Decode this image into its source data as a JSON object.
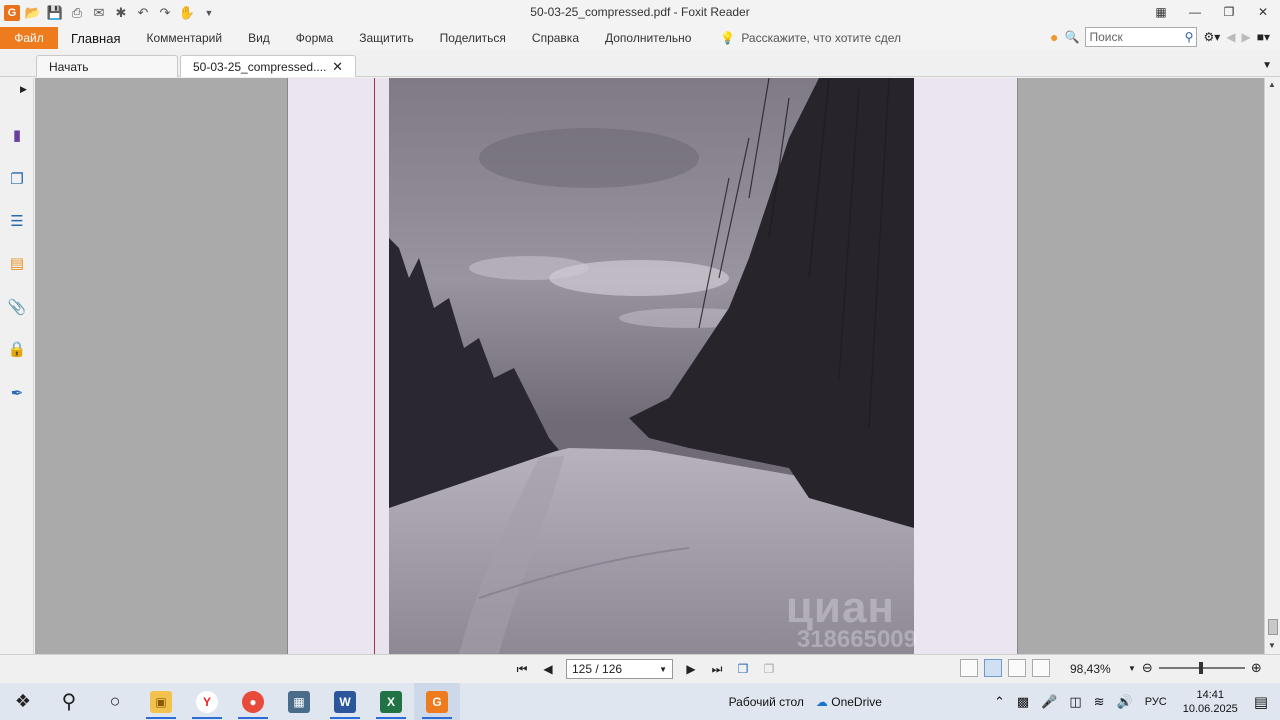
{
  "window": {
    "title": "50-03-25_compressed.pdf - Foxit Reader"
  },
  "menu": {
    "file": "Файл",
    "items": [
      "Главная",
      "Комментарий",
      "Вид",
      "Форма",
      "Защитить",
      "Поделиться",
      "Справка",
      "Дополнительно"
    ],
    "tell_me": "Расскажите, что хотите сдел",
    "search_placeholder": "Поиск"
  },
  "tabs": {
    "start": "Начать",
    "doc": "50-03-25_compressed...."
  },
  "watermark": {
    "line1": "циан",
    "line2": "318665009"
  },
  "status": {
    "page": "125 / 126",
    "zoom": "98,43%"
  },
  "taskbar": {
    "desktop_label": "Рабочий стол",
    "onedrive_label": "OneDrive",
    "lang": "РУС",
    "time": "14:41",
    "date": "10.06.2025"
  },
  "colors": {
    "accent": "#ee7b1e",
    "page_bg": "#e9e3ef",
    "canvas_bg": "#aaaaaa"
  },
  "icons": {
    "sidebar": [
      "bookmark-icon",
      "pages-icon",
      "layers-icon",
      "comments-icon",
      "attachments-icon",
      "security-icon",
      "signature-icon"
    ]
  }
}
